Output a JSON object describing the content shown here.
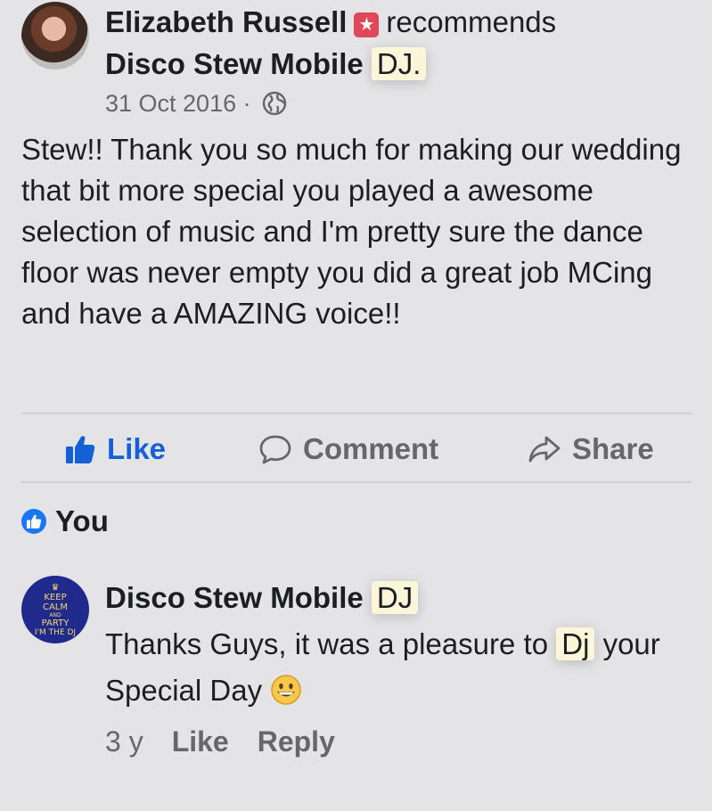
{
  "post": {
    "author": "Elizabeth Russell",
    "recommends": "recommends",
    "page_name_main": "Disco Stew Mobile",
    "page_name_highlight": "DJ.",
    "date": "31 Oct 2016",
    "separator": "·",
    "body": "Stew!! Thank you so much for making our wedding that bit more special you played a awesome selection of music and I'm pretty sure the dance floor was never empty you did a great job MCing and have a AMAZING voice!!"
  },
  "actions": {
    "like": "Like",
    "comment": "Comment",
    "share": "Share",
    "like_color": "#1560d6"
  },
  "reactions": {
    "label": "You"
  },
  "comment": {
    "author_main": "Disco Stew Mobile",
    "author_highlight": "DJ",
    "text_before": "Thanks Guys, it was a pleasure to",
    "text_highlight": "Dj",
    "text_after": "your Special Day",
    "emoji": "grinning-face-icon",
    "time": "3 y",
    "like": "Like",
    "reply": "Reply",
    "avatar_text": [
      "KEEP",
      "CALM",
      "AND",
      "PARTY",
      "I'M THE DJ"
    ]
  },
  "colors": {
    "background": "#e4e4e6",
    "accent": "#1877f2",
    "highlight": "#fbf6d9"
  }
}
